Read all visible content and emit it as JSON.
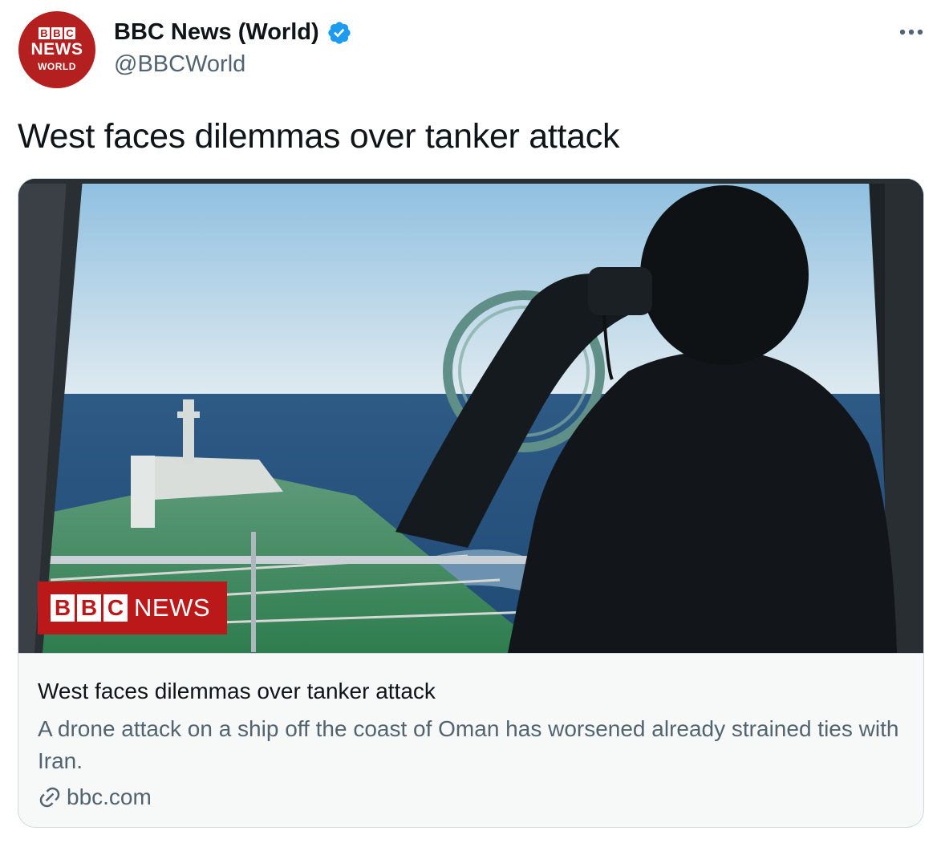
{
  "account": {
    "avatar": {
      "blocks": [
        "B",
        "B",
        "C"
      ],
      "news": "NEWS",
      "world": "WORLD"
    },
    "display_name": "BBC News (World)",
    "handle": "@BBCWorld",
    "verified": true
  },
  "tweet": {
    "text": "West faces dilemmas over tanker attack"
  },
  "card": {
    "watermark": {
      "blocks": [
        "B",
        "B",
        "C"
      ],
      "label": "NEWS"
    },
    "title": "West faces dilemmas over tanker attack",
    "description": "A drone attack on a ship off the coast of Oman has worsened already strained ties with Iran.",
    "domain": "bbc.com"
  },
  "colors": {
    "brand_red": "#bb1919",
    "verified_blue": "#1d9bf0",
    "secondary_text": "#536471",
    "border": "#cfd9de"
  },
  "icons": [
    "verified-badge-icon",
    "more-icon",
    "link-icon"
  ]
}
